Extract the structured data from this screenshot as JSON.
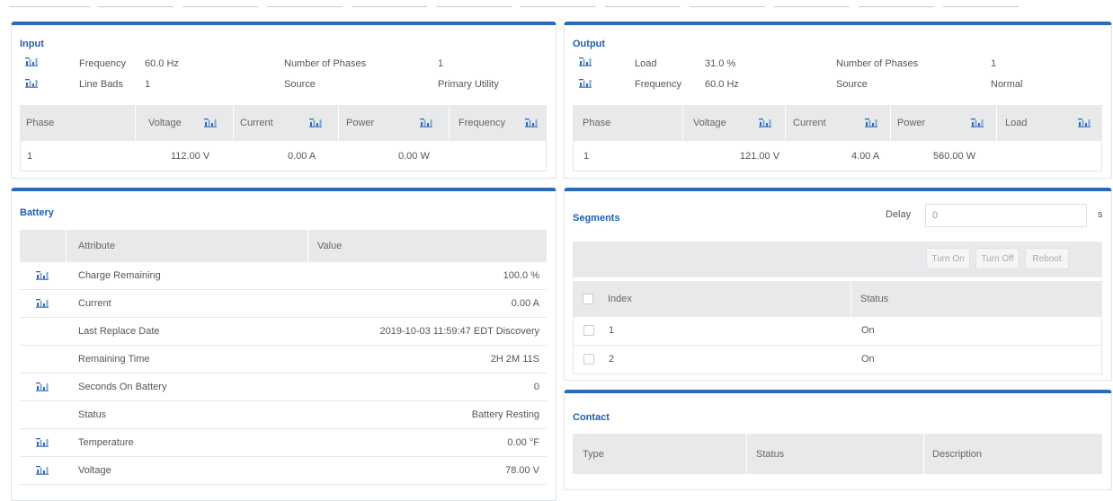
{
  "input": {
    "title": "Input",
    "frequency_label": "Frequency",
    "frequency_value": "60.0 Hz",
    "line_bads_label": "Line Bads",
    "line_bads_value": "1",
    "phases_label": "Number of Phases",
    "phases_value": "1",
    "source_label": "Source",
    "source_value": "Primary Utility",
    "columns": [
      "Phase",
      "Voltage",
      "Current",
      "Power",
      "Frequency"
    ],
    "rows": [
      {
        "phase": "1",
        "voltage": "112.00 V",
        "current": "0.00 A",
        "power": "0.00 W",
        "frequency": ""
      }
    ]
  },
  "output": {
    "title": "Output",
    "load_label": "Load",
    "load_value": "31.0 %",
    "frequency_label": "Frequency",
    "frequency_value": "60.0 Hz",
    "phases_label": "Number of Phases",
    "phases_value": "1",
    "source_label": "Source",
    "source_value": "Normal",
    "columns": [
      "Phase",
      "Voltage",
      "Current",
      "Power",
      "Load"
    ],
    "rows": [
      {
        "phase": "1",
        "voltage": "121.00 V",
        "current": "4.00 A",
        "power": "560.00 W",
        "load": ""
      }
    ]
  },
  "battery": {
    "title": "Battery",
    "columns": [
      "Attribute",
      "Value"
    ],
    "rows": [
      {
        "attribute": "Charge Remaining",
        "value": "100.0 %",
        "icon": "chart-icon"
      },
      {
        "attribute": "Current",
        "value": "0.00 A",
        "icon": "chart-icon"
      },
      {
        "attribute": "Last Replace Date",
        "value": "2019-10-03 11:59:47 EDT Discovery",
        "icon": ""
      },
      {
        "attribute": "Remaining Time",
        "value": "2H 2M 11S",
        "icon": ""
      },
      {
        "attribute": "Seconds On Battery",
        "value": "0",
        "icon": "chart-icon"
      },
      {
        "attribute": "Status",
        "value": "Battery Resting",
        "icon": ""
      },
      {
        "attribute": "Temperature",
        "value": "0.00 °F",
        "icon": "chart-icon"
      },
      {
        "attribute": "Voltage",
        "value": "78.00 V",
        "icon": "chart-icon"
      }
    ]
  },
  "segments": {
    "title": "Segments",
    "delay_label": "Delay",
    "delay_value": "0",
    "delay_unit": "s",
    "buttons": {
      "turn_on": "Turn On",
      "turn_off": "Turn Off",
      "reboot": "Reboot"
    },
    "columns": [
      "Index",
      "Status"
    ],
    "rows": [
      {
        "index": "1",
        "status": "On"
      },
      {
        "index": "2",
        "status": "On"
      }
    ]
  },
  "contact": {
    "title": "Contact",
    "columns": [
      "Type",
      "Status",
      "Description"
    ]
  },
  "colors": {
    "accent": "#2a6ab8",
    "title": "#1d5fb3",
    "header_bg": "#e8e9eb"
  }
}
